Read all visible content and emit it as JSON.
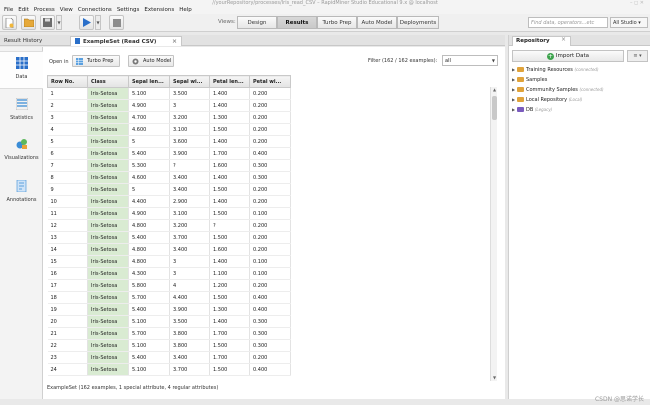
{
  "titlebar": {
    "text": "//yourRepository/processes/Iris_read_CSV – RapidMiner Studio Educational 9.x @ localhost"
  },
  "menu": [
    "File",
    "Edit",
    "Process",
    "View",
    "Connections",
    "Settings",
    "Extensions",
    "Help"
  ],
  "toolbar": {
    "icons": [
      "new-process-icon",
      "open-folder-icon",
      "save-icon",
      "run-icon",
      "stop-icon"
    ],
    "views_label": "Views:",
    "views": [
      "Design",
      "Results",
      "Turbo Prep",
      "Auto Model",
      "Deployments"
    ],
    "active_view": "Results",
    "search_placeholder": "Find data, operators...etc",
    "studio_select": "All Studio"
  },
  "left_tabs": {
    "history": "Result History",
    "example_set": "ExampleSet (Read CSV)"
  },
  "side_nav": [
    {
      "label": "Data",
      "icon": "data-grid-icon"
    },
    {
      "label": "Statistics",
      "icon": "statistics-icon"
    },
    {
      "label": "Visualizations",
      "icon": "visualizations-icon"
    },
    {
      "label": "Annotations",
      "icon": "annotations-icon"
    }
  ],
  "content": {
    "open_in": "Open in",
    "turbo_prep": "Turbo Prep",
    "auto_model": "Auto Model",
    "filter_label": "Filter (162 / 162 examples):",
    "filter_value": "all"
  },
  "table": {
    "columns": [
      "Row No.",
      "Class",
      "Sepal len...",
      "Sepal wi...",
      "Petal len...",
      "Petal wi..."
    ],
    "rows": [
      [
        "1",
        "Iris-Setosa",
        "5.100",
        "3.500",
        "1.400",
        "0.200"
      ],
      [
        "2",
        "Iris-Setosa",
        "4.900",
        "3",
        "1.400",
        "0.200"
      ],
      [
        "3",
        "Iris-Setosa",
        "4.700",
        "3.200",
        "1.300",
        "0.200"
      ],
      [
        "4",
        "Iris-Setosa",
        "4.600",
        "3.100",
        "1.500",
        "0.200"
      ],
      [
        "5",
        "Iris-Setosa",
        "5",
        "3.600",
        "1.400",
        "0.200"
      ],
      [
        "6",
        "Iris-Setosa",
        "5.400",
        "3.900",
        "1.700",
        "0.400"
      ],
      [
        "7",
        "Iris-Setosa",
        "5.300",
        "?",
        "1.600",
        "0.300"
      ],
      [
        "8",
        "Iris-Setosa",
        "4.600",
        "3.400",
        "1.400",
        "0.300"
      ],
      [
        "9",
        "Iris-Setosa",
        "5",
        "3.400",
        "1.500",
        "0.200"
      ],
      [
        "10",
        "Iris-Setosa",
        "4.400",
        "2.900",
        "1.400",
        "0.200"
      ],
      [
        "11",
        "Iris-Setosa",
        "4.900",
        "3.100",
        "1.500",
        "0.100"
      ],
      [
        "12",
        "Iris-Setosa",
        "4.800",
        "3.200",
        "?",
        "0.200"
      ],
      [
        "13",
        "Iris-Setosa",
        "5.400",
        "3.700",
        "1.500",
        "0.200"
      ],
      [
        "14",
        "Iris-Setosa",
        "4.800",
        "3.400",
        "1.600",
        "0.200"
      ],
      [
        "15",
        "Iris-Setosa",
        "4.800",
        "3",
        "1.400",
        "0.100"
      ],
      [
        "16",
        "Iris-Setosa",
        "4.300",
        "3",
        "1.100",
        "0.100"
      ],
      [
        "17",
        "Iris-Setosa",
        "5.800",
        "4",
        "1.200",
        "0.200"
      ],
      [
        "18",
        "Iris-Setosa",
        "5.700",
        "4.400",
        "1.500",
        "0.400"
      ],
      [
        "19",
        "Iris-Setosa",
        "5.400",
        "3.900",
        "1.300",
        "0.400"
      ],
      [
        "20",
        "Iris-Setosa",
        "5.100",
        "3.500",
        "1.400",
        "0.300"
      ],
      [
        "21",
        "Iris-Setosa",
        "5.700",
        "3.800",
        "1.700",
        "0.300"
      ],
      [
        "22",
        "Iris-Setosa",
        "5.100",
        "3.800",
        "1.500",
        "0.300"
      ],
      [
        "23",
        "Iris-Setosa",
        "5.400",
        "3.400",
        "1.700",
        "0.200"
      ],
      [
        "24",
        "Iris-Setosa",
        "5.100",
        "3.700",
        "1.500",
        "0.400"
      ]
    ]
  },
  "status": "ExampleSet (162 examples, 1 special attribute, 4 regular attributes)",
  "repository": {
    "title": "Repository",
    "import_label": "Import Data",
    "items": [
      {
        "label": "Training Resources",
        "note": "(connected)",
        "color": "#e0a33a"
      },
      {
        "label": "Samples",
        "note": "",
        "color": "#e0a33a"
      },
      {
        "label": "Community Samples",
        "note": "(connected)",
        "color": "#e0a33a"
      },
      {
        "label": "Local Repository",
        "note": "(Local)",
        "color": "#e0a33a"
      },
      {
        "label": "DB",
        "note": "(Legacy)",
        "color": "#7a5bbd"
      }
    ]
  },
  "watermark": "CSDN @思诺学长",
  "colors": {
    "class_cell": "#d9ebd2",
    "accent": "#2a6fc9"
  }
}
